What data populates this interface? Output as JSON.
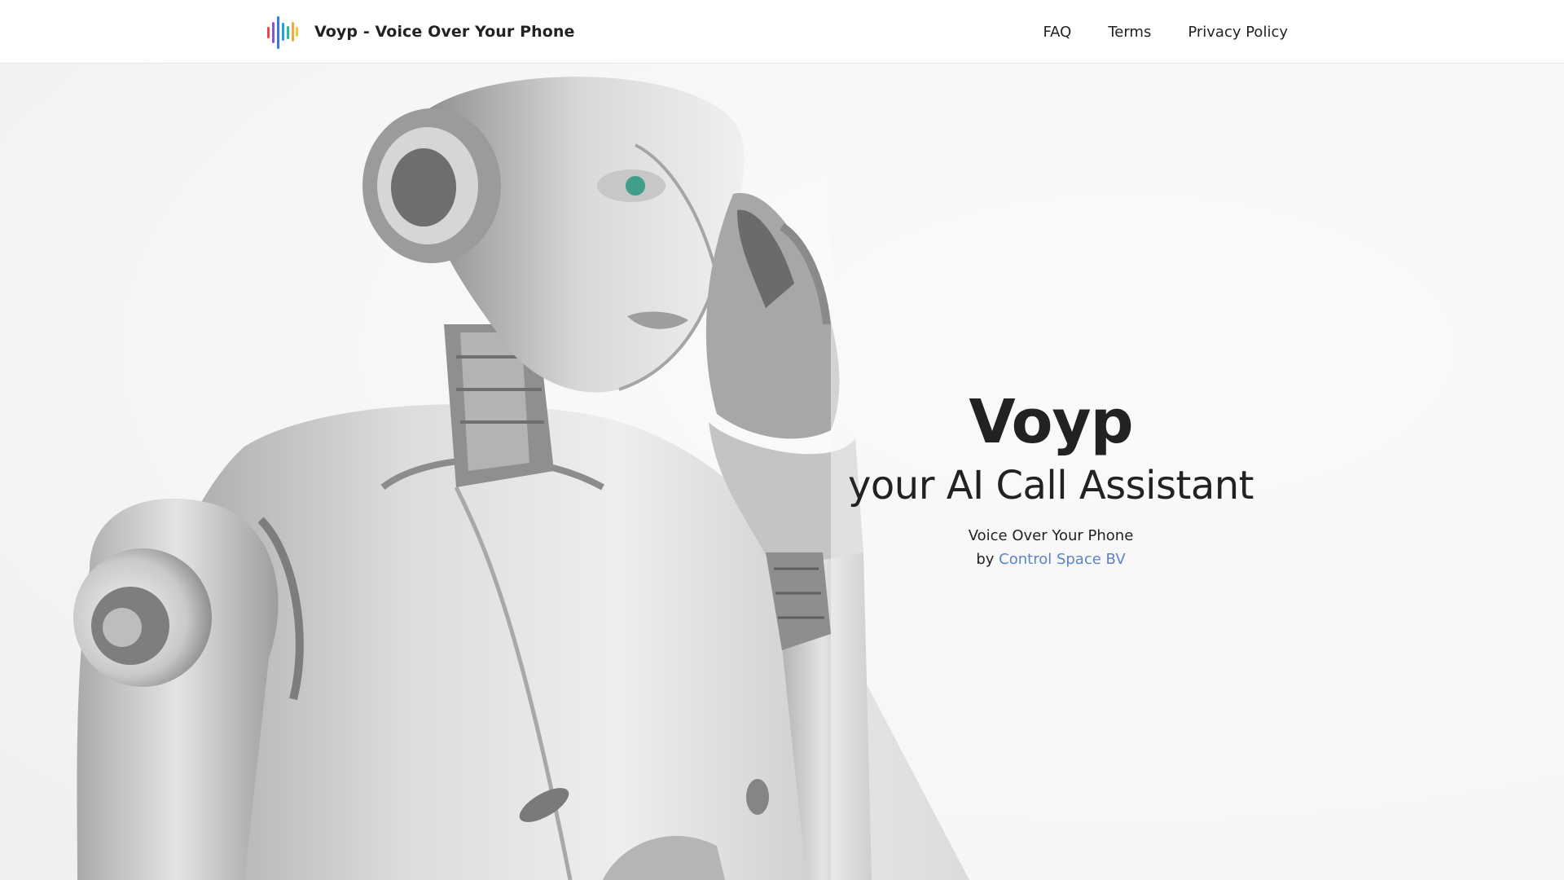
{
  "header": {
    "brand_title": "Voyp - Voice Over Your Phone",
    "logo_icon": "sound-wave-icon",
    "nav": [
      {
        "label": "FAQ"
      },
      {
        "label": "Terms"
      },
      {
        "label": "Privacy Policy"
      }
    ]
  },
  "hero": {
    "title": "Voyp",
    "subtitle": "your AI Call Assistant",
    "tagline": "Voice Over Your Phone",
    "by_prefix": "by",
    "company_link": "Control Space BV",
    "image_subject": "robot-on-phone"
  },
  "colors": {
    "text": "#222222",
    "link": "#5b84c4",
    "logo_bars": [
      "#e8484c",
      "#8a55d4",
      "#3a7bd5",
      "#1aa0e0",
      "#2bbd9b",
      "#f1a93a",
      "#f6c73b"
    ]
  }
}
